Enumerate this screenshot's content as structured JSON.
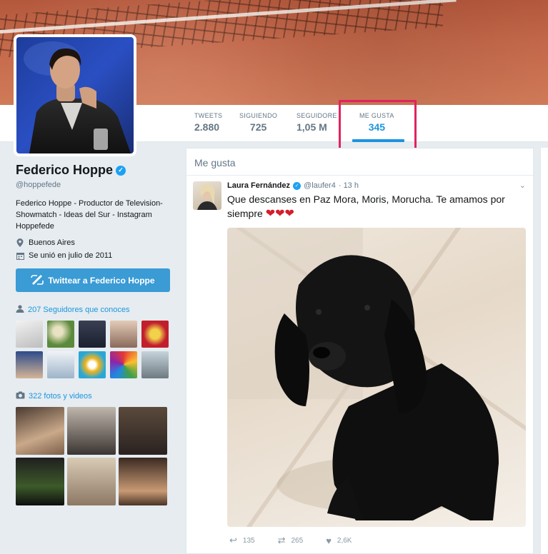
{
  "profile": {
    "name": "Federico Hoppe",
    "handle": "@hoppefede",
    "bio": "Federico Hoppe - Productor de Television- Showmatch - Ideas del Sur - Instagram Hoppefede",
    "location": "Buenos Aires",
    "joined": "Se unió en julio de 2011",
    "tweet_to_label": "Twittear a Federico Hoppe",
    "followers_you_know": "207 Seguidores que conoces",
    "photos_videos": "322 fotos y videos"
  },
  "nav": {
    "stats": [
      {
        "label": "TWEETS",
        "value": "2.880"
      },
      {
        "label": "SIGUIENDO",
        "value": "725"
      },
      {
        "label": "SEGUIDORE",
        "value": "1,05 M"
      },
      {
        "label": "ME GUSTA",
        "value": "345"
      }
    ]
  },
  "feed": {
    "title": "Me gusta",
    "tweet": {
      "author": "Laura Fernández",
      "handle": "@laufer4",
      "time": "· 13 h",
      "text": "Que descanses en Paz Mora, Moris, Morucha. Te amamos por siempre",
      "hearts": "❤❤❤",
      "replies": "135",
      "retweets": "265",
      "likes": "2,6K"
    }
  },
  "colors": {
    "accent": "#1b95e0",
    "highlight": "#e0245e",
    "button": "#3a9bd5"
  },
  "icons": {
    "verified": "verified-badge-icon",
    "location": "location-pin-icon",
    "calendar": "calendar-icon",
    "followers": "person-icon",
    "camera": "camera-icon",
    "quill": "compose-quill-icon",
    "reply": "reply-icon",
    "retweet": "retweet-icon",
    "like": "heart-icon"
  }
}
